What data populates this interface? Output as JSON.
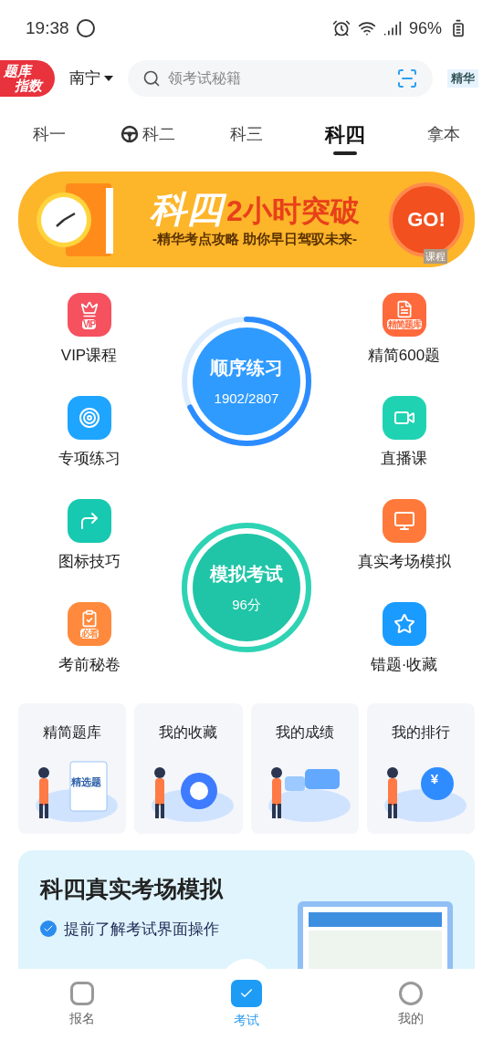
{
  "status_bar": {
    "time": "19:38",
    "battery": "96%"
  },
  "header": {
    "logo_lines": [
      "题库",
      "指数"
    ],
    "city": "南宁",
    "search": {
      "placeholder": "领考试秘籍"
    },
    "badge": "精华"
  },
  "tabs": [
    {
      "label": "科一",
      "selected": false
    },
    {
      "label": "科二",
      "selected": false,
      "kind": "wheel"
    },
    {
      "label": "科三",
      "selected": false
    },
    {
      "label": "科四",
      "selected": true
    },
    {
      "label": "拿本",
      "selected": false
    }
  ],
  "banner": {
    "title": "科四",
    "title_rest": "2小时突破",
    "subtitle": "-精华考点攻略 助你早日驾驭未来-",
    "button": "GO!",
    "tag": "课程"
  },
  "left_items": [
    {
      "label": "VIP课程",
      "color": "#f5515f",
      "icon_text": "VIP"
    },
    {
      "label": "专项练习",
      "color": "#1ea5ff"
    },
    {
      "label": "图标技巧",
      "color": "#16c9b0"
    },
    {
      "label": "考前秘卷",
      "color": "#ff8a3d",
      "icon_text": "必看"
    }
  ],
  "right_items": [
    {
      "label": "精简600题",
      "color": "#ff6a3d",
      "icon_text": "精简题库"
    },
    {
      "label": "直播课",
      "color": "#1fd3b2"
    },
    {
      "label": "真实考场模拟",
      "color": "#ff7a3a"
    },
    {
      "label": "错题·收藏",
      "color": "#1a9bff"
    }
  ],
  "practice": {
    "title": "顺序练习",
    "progress": "1902/2807",
    "level": 0.68
  },
  "exam": {
    "title": "模拟考试",
    "score": "96分"
  },
  "cards": [
    {
      "title": "精简题库",
      "tag": "精选题"
    },
    {
      "title": "我的收藏"
    },
    {
      "title": "我的成绩"
    },
    {
      "title": "我的排行",
      "tag": "¥"
    }
  ],
  "promo": {
    "title": "科四真实考场模拟",
    "bullets": [
      "提前了解考试界面操作"
    ]
  },
  "bottom_nav": [
    {
      "label": "报名",
      "selected": false
    },
    {
      "label": "考试",
      "selected": true
    },
    {
      "label": "我的",
      "selected": false
    }
  ]
}
